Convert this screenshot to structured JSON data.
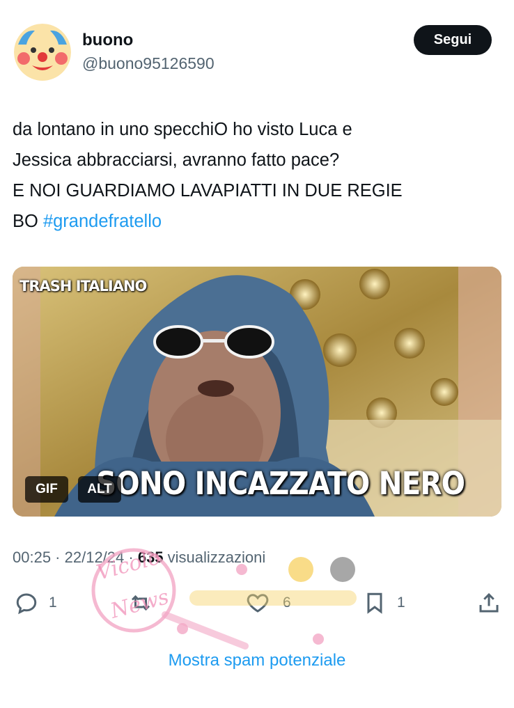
{
  "user": {
    "display_name": "buono",
    "handle": "@buono95126590",
    "follow_label": "Segui"
  },
  "tweet": {
    "lines": [
      "da lontano in uno specchiO ho visto Luca e",
      "Jessica abbracciarsi, avranno fatto pace?",
      "E NOI GUARDIAMO LAVAPIATTI IN DUE REGIE"
    ],
    "last_line_prefix": "BO ",
    "hashtag": "#grandefratello"
  },
  "media": {
    "watermark_text": "TRASH ITALIANO",
    "caption": "SONO INCAZZATO NERO",
    "gif_label": "GIF",
    "alt_label": "ALT"
  },
  "meta": {
    "time": "00:25",
    "separator": " · ",
    "date": "22/12/24",
    "views_count": "635",
    "views_label": " visualizzazioni"
  },
  "actions": {
    "replies": "1",
    "likes": "6",
    "bookmarks": "1"
  },
  "spam_link": "Mostra spam potenziale",
  "icons": [
    "clown-avatar-icon",
    "reply-icon",
    "retweet-icon",
    "heart-icon",
    "bookmark-icon",
    "share-icon"
  ],
  "colors": {
    "link": "#1d9bf0",
    "text": "#0f1419",
    "muted": "#536471"
  }
}
